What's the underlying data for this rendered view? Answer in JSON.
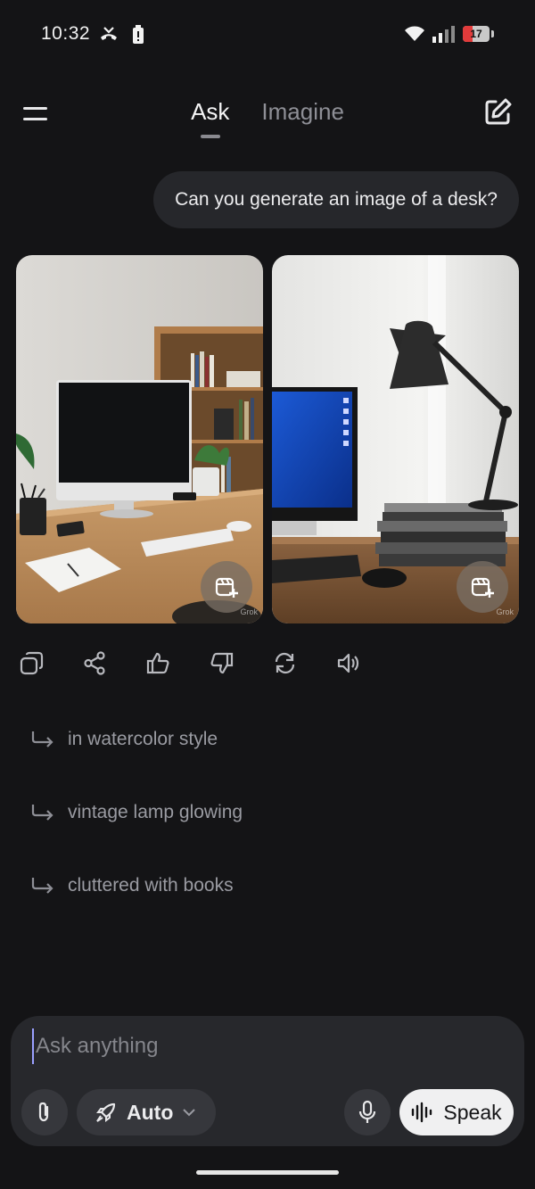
{
  "status_bar": {
    "time": "10:32",
    "battery_level": "17",
    "battery_color": "#e23b3b"
  },
  "header": {
    "tabs": [
      {
        "label": "Ask",
        "active": true
      },
      {
        "label": "Imagine",
        "active": false
      }
    ]
  },
  "conversation": {
    "user_message": "Can you generate an image of a desk?",
    "images": [
      {
        "subject": "desk with white monitor, bookshelf and plant",
        "watermark": "Grok"
      },
      {
        "subject": "desk with black lamp, blue screen and stacked books",
        "watermark": "Grok"
      }
    ],
    "actions": [
      {
        "name": "copy-icon"
      },
      {
        "name": "share-icon"
      },
      {
        "name": "thumbs-up-icon"
      },
      {
        "name": "thumbs-down-icon"
      },
      {
        "name": "regenerate-icon"
      },
      {
        "name": "speaker-icon"
      }
    ],
    "suggestions": [
      {
        "text": "in watercolor style"
      },
      {
        "text": "vintage lamp glowing"
      },
      {
        "text": "cluttered with books"
      }
    ]
  },
  "composer": {
    "placeholder": "Ask anything",
    "mode_label": "Auto",
    "speak_label": "Speak"
  },
  "colors": {
    "background": "#141416",
    "bubble": "#26272b",
    "composer": "#27282c",
    "accent_white": "#f0f0f1"
  }
}
